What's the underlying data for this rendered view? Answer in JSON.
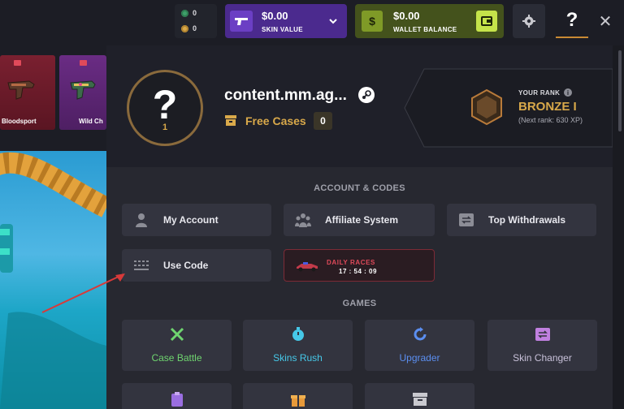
{
  "topbar": {
    "coins": [
      {
        "color": "#3e9f6a",
        "value": "0"
      },
      {
        "color": "#d9a94a",
        "value": "0"
      }
    ],
    "skin_value": {
      "amount": "$0.00",
      "label": "SKIN VALUE",
      "icon": "pistol-icon",
      "accent": "#4b2a8e"
    },
    "wallet_balance": {
      "amount": "$0.00",
      "label": "WALLET BALANCE",
      "icon": "dollar-icon",
      "button_icon": "wallet-icon",
      "accent": "#44521c"
    },
    "settings_icon": "gear-icon",
    "help_glyph": "?",
    "close_glyph": "✕"
  },
  "left": {
    "cases": [
      {
        "name": "Bloodsport",
        "color": "#7a2030"
      },
      {
        "name": "Wild Ch",
        "color": "#6a2c84"
      }
    ]
  },
  "profile": {
    "avatar_glyph": "?",
    "level": "1",
    "username": "content.mm.ag...",
    "free_cases_label": "Free Cases",
    "free_cases_count": "0"
  },
  "rank": {
    "title": "YOUR RANK",
    "name": "BRONZE I",
    "next": "(Next rank: 630 XP)"
  },
  "account": {
    "title": "ACCOUNT & CODES",
    "buttons": [
      {
        "label": "My Account",
        "icon": "user-icon"
      },
      {
        "label": "Affiliate System",
        "icon": "group-icon"
      },
      {
        "label": "Top Withdrawals",
        "icon": "swap-icon"
      },
      {
        "label": "Use Code",
        "icon": "keyboard-icon"
      }
    ],
    "races": {
      "label": "DAILY RACES",
      "timer": "17 : 54 : 09"
    }
  },
  "games": {
    "title": "GAMES",
    "items": [
      {
        "label": "Case Battle",
        "color": "#6fd46f",
        "icon": "swords-icon"
      },
      {
        "label": "Skins Rush",
        "color": "#46c8e8",
        "icon": "stopwatch-icon"
      },
      {
        "label": "Upgrader",
        "color": "#5b8ef0",
        "icon": "upgrade-icon"
      },
      {
        "label": "Skin Changer",
        "color": "#c7c0d8",
        "icon": "exchange-icon"
      }
    ]
  }
}
